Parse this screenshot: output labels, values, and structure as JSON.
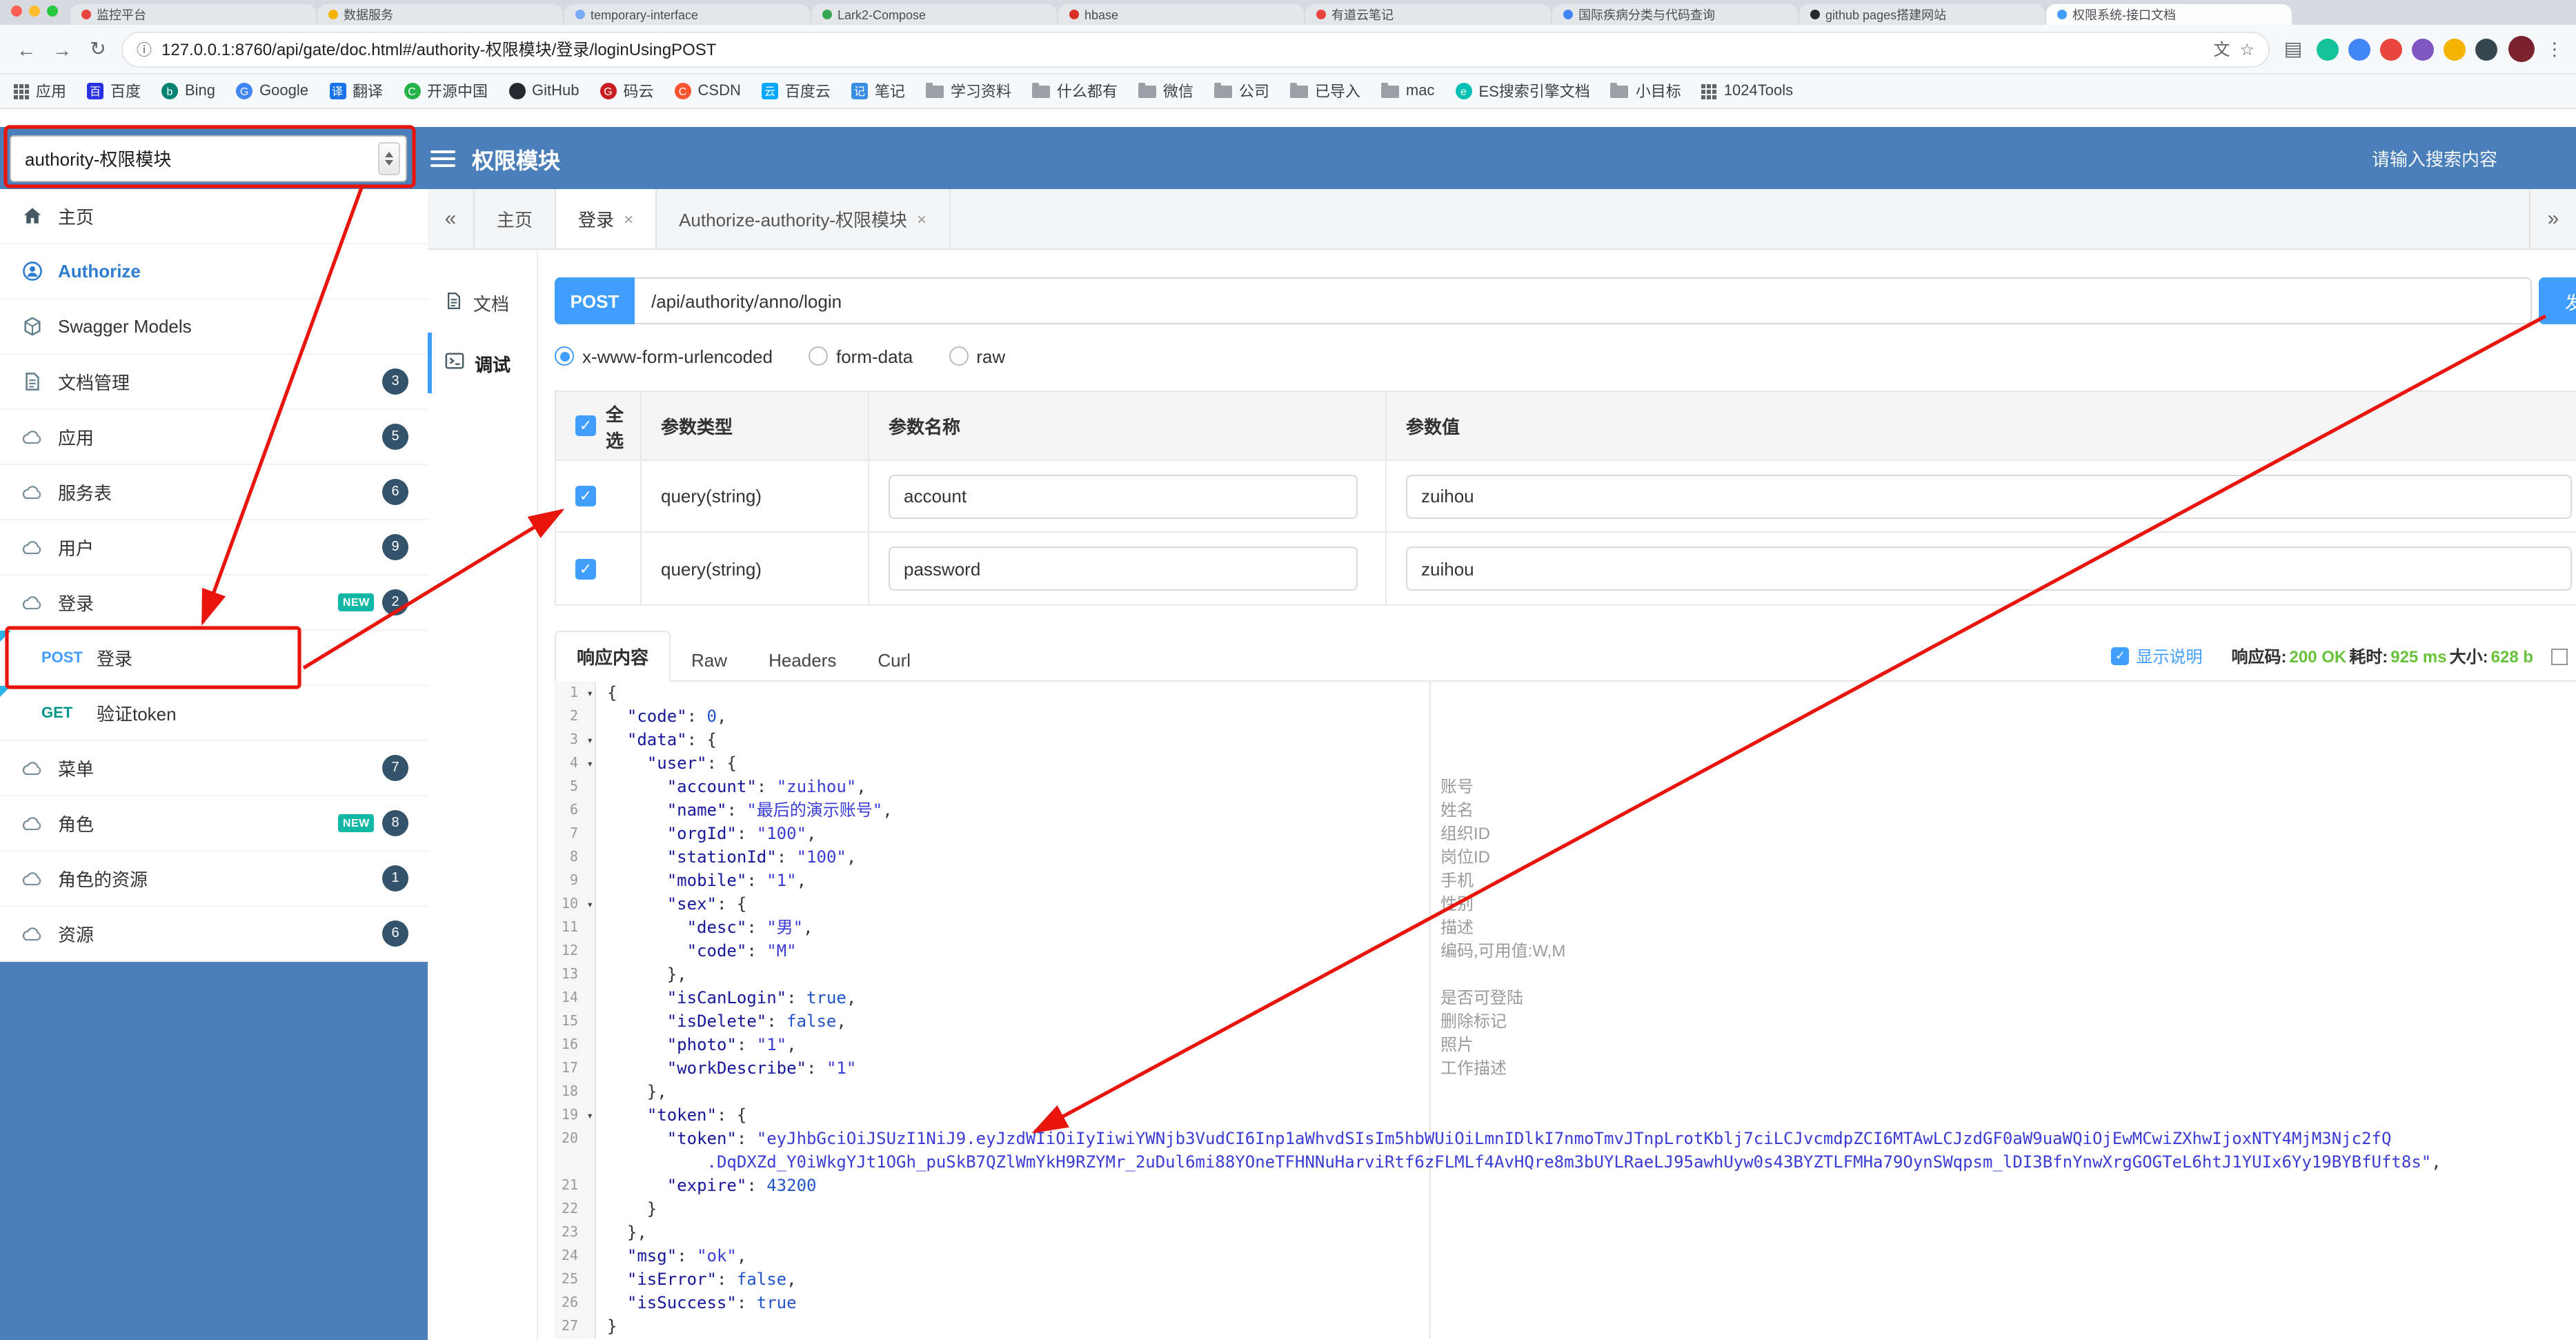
{
  "browser": {
    "window_lights": [
      "#ff5f57",
      "#febc2e",
      "#28c840"
    ],
    "tabs": [
      {
        "title": "监控平台",
        "favicon_color": "#e8453c"
      },
      {
        "title": "数据服务",
        "favicon_color": "#f4b400"
      },
      {
        "title": "temporary-interface",
        "favicon_color": "#7baaf7"
      },
      {
        "title": "Lark2-Compose",
        "favicon_color": "#34a853"
      },
      {
        "title": "hbase",
        "favicon_color": "#d93025"
      },
      {
        "title": "有道云笔记",
        "favicon_color": "#e8453c"
      },
      {
        "title": "国际疾病分类与代码查询",
        "favicon_color": "#4285f4"
      },
      {
        "title": "github pages搭建网站",
        "favicon_color": "#24292e"
      },
      {
        "title": "权限系统-接口文档",
        "favicon_color": "#409eff",
        "active": true
      }
    ],
    "toolbar": {
      "glyphs": {
        "back": "←",
        "forward": "→",
        "reload": "↻",
        "info": "ⓘ",
        "translate": "文",
        "star": "☆",
        "side_panel": "▤",
        "menu": "⋮"
      },
      "url": "127.0.0.1:8760/api/gate/doc.html#/authority-权限模块/登录/loginUsingPOST",
      "extension_colors": [
        "#15c39a",
        "#4285f4",
        "#e8453c",
        "#7e57c2",
        "#f4b400",
        "#37474f"
      ]
    },
    "bookmarks": [
      {
        "label": "应用",
        "icon": "apps-grid"
      },
      {
        "label": "百度",
        "icon": "letter",
        "text": "百",
        "bg": "#2932e1"
      },
      {
        "label": "Bing",
        "icon": "letter",
        "text": "b",
        "bg": "#008373",
        "shape": "circle"
      },
      {
        "label": "Google",
        "icon": "letter",
        "text": "G",
        "bg": "#4285f4",
        "shape": "circle"
      },
      {
        "label": "翻译",
        "icon": "letter",
        "text": "译",
        "bg": "#1a73e8"
      },
      {
        "label": "开源中国",
        "icon": "letter",
        "text": "C",
        "bg": "#24b34b",
        "shape": "circle"
      },
      {
        "label": "GitHub",
        "icon": "letter",
        "text": "",
        "bg": "#24292e",
        "shape": "circle"
      },
      {
        "label": "码云",
        "icon": "letter",
        "text": "G",
        "bg": "#c71d23",
        "shape": "circle"
      },
      {
        "label": "CSDN",
        "icon": "letter",
        "text": "C",
        "bg": "#fc5531",
        "shape": "circle"
      },
      {
        "label": "百度云",
        "icon": "letter",
        "text": "云",
        "bg": "#06a7ff"
      },
      {
        "label": "笔记",
        "icon": "letter",
        "text": "记",
        "bg": "#3a8ee6"
      },
      {
        "label": "学习资料",
        "icon": "folder"
      },
      {
        "label": "什么都有",
        "icon": "folder"
      },
      {
        "label": "微信",
        "icon": "folder"
      },
      {
        "label": "公司",
        "icon": "folder"
      },
      {
        "label": "已导入",
        "icon": "folder"
      },
      {
        "label": "mac",
        "icon": "folder"
      },
      {
        "label": "ES搜索引擎文档",
        "icon": "letter",
        "text": "e",
        "bg": "#00bfb3",
        "shape": "circle"
      },
      {
        "label": "小目标",
        "icon": "folder"
      },
      {
        "label": "1024Tools",
        "icon": "tools-grid"
      }
    ]
  },
  "header": {
    "module_select": "authority-权限模块",
    "title": "权限模块",
    "search_placeholder": "请输入搜索内容"
  },
  "sidebar": {
    "items": [
      {
        "label": "主页",
        "icon": "home-icon"
      },
      {
        "label": "Authorize",
        "icon": "authorize-icon",
        "highlight": true
      },
      {
        "label": "Swagger Models",
        "icon": "models-icon"
      },
      {
        "label": "文档管理",
        "icon": "docs-icon",
        "badge": "3"
      },
      {
        "label": "应用",
        "icon": "cloud-icon",
        "badge": "5"
      },
      {
        "label": "服务表",
        "icon": "cloud-icon",
        "badge": "6"
      },
      {
        "label": "用户",
        "icon": "cloud-icon",
        "badge": "9"
      },
      {
        "label": "登录",
        "icon": "cloud-icon",
        "badge": "2",
        "new_tag": "NEW",
        "expanded": true
      },
      {
        "type": "operation",
        "method": "POST",
        "label": "登录"
      },
      {
        "type": "operation",
        "method": "GET",
        "label": "验证token"
      },
      {
        "label": "菜单",
        "icon": "cloud-icon",
        "badge": "7"
      },
      {
        "label": "角色",
        "icon": "cloud-icon",
        "badge": "8",
        "new_tag": "NEW"
      },
      {
        "label": "角色的资源",
        "icon": "cloud-icon",
        "badge": "1"
      },
      {
        "label": "资源",
        "icon": "cloud-icon",
        "badge": "6"
      }
    ]
  },
  "main_tabs": {
    "collapse_left": "«",
    "collapse_right": "»",
    "items": [
      {
        "label": "主页"
      },
      {
        "label": "登录",
        "closable": true,
        "active": true
      },
      {
        "label": "Authorize-authority-权限模块",
        "closable": true
      }
    ]
  },
  "doc_tabs": {
    "items": [
      {
        "label": "文档",
        "icon": "doc-icon"
      },
      {
        "label": "调试",
        "icon": "debug-icon",
        "active": true
      }
    ]
  },
  "request": {
    "method": "POST",
    "url": "/api/authority/anno/login",
    "send_button_label": "发送",
    "content_types": [
      {
        "label": "x-www-form-urlencoded",
        "selected": true
      },
      {
        "label": "form-data",
        "selected": false
      },
      {
        "label": "raw",
        "selected": false
      }
    ],
    "params_table": {
      "select_all_label": "全选",
      "columns": [
        "参数类型",
        "参数名称",
        "参数值"
      ],
      "rows": [
        {
          "checked": true,
          "type": "query(string)",
          "name": "account",
          "value": "zuihou"
        },
        {
          "checked": true,
          "type": "query(string)",
          "name": "password",
          "value": "zuihou"
        }
      ]
    }
  },
  "response": {
    "tabs": [
      {
        "label": "响应内容",
        "active": true
      },
      {
        "label": "Raw"
      },
      {
        "label": "Headers"
      },
      {
        "label": "Curl"
      }
    ],
    "show_description": {
      "checked": true,
      "label": "显示说明"
    },
    "status": {
      "code_label": "响应码:",
      "code": "200 OK",
      "time_label": "耗时:",
      "time": "925 ms",
      "size_label": "大小:",
      "size": "628 b"
    }
  },
  "editor": {
    "fold_glyph": "▾",
    "rows": [
      {
        "n": "1",
        "fold": true,
        "t": [
          [
            "p",
            "{"
          ]
        ]
      },
      {
        "n": "2",
        "t": [
          [
            "p",
            "  "
          ],
          [
            "k",
            "\"code\""
          ],
          [
            "p",
            ": "
          ],
          [
            "n",
            "0"
          ],
          [
            "p",
            ","
          ]
        ]
      },
      {
        "n": "3",
        "fold": true,
        "t": [
          [
            "p",
            "  "
          ],
          [
            "k",
            "\"data\""
          ],
          [
            "p",
            ": {"
          ]
        ]
      },
      {
        "n": "4",
        "fold": true,
        "t": [
          [
            "p",
            "    "
          ],
          [
            "k",
            "\"user\""
          ],
          [
            "p",
            ": {"
          ]
        ]
      },
      {
        "n": "5",
        "t": [
          [
            "p",
            "      "
          ],
          [
            "k",
            "\"account\""
          ],
          [
            "p",
            ": "
          ],
          [
            "s",
            "\"zuihou\""
          ],
          [
            "p",
            ","
          ]
        ],
        "a": "账号"
      },
      {
        "n": "6",
        "t": [
          [
            "p",
            "      "
          ],
          [
            "k",
            "\"name\""
          ],
          [
            "p",
            ": "
          ],
          [
            "s",
            "\"最后的演示账号\""
          ],
          [
            "p",
            ","
          ]
        ],
        "a": "姓名"
      },
      {
        "n": "7",
        "t": [
          [
            "p",
            "      "
          ],
          [
            "k",
            "\"orgId\""
          ],
          [
            "p",
            ": "
          ],
          [
            "s",
            "\"100\""
          ],
          [
            "p",
            ","
          ]
        ],
        "a": "组织ID"
      },
      {
        "n": "8",
        "t": [
          [
            "p",
            "      "
          ],
          [
            "k",
            "\"stationId\""
          ],
          [
            "p",
            ": "
          ],
          [
            "s",
            "\"100\""
          ],
          [
            "p",
            ","
          ]
        ],
        "a": "岗位ID"
      },
      {
        "n": "9",
        "t": [
          [
            "p",
            "      "
          ],
          [
            "k",
            "\"mobile\""
          ],
          [
            "p",
            ": "
          ],
          [
            "s",
            "\"1\""
          ],
          [
            "p",
            ","
          ]
        ],
        "a": "手机"
      },
      {
        "n": "10",
        "fold": true,
        "t": [
          [
            "p",
            "      "
          ],
          [
            "k",
            "\"sex\""
          ],
          [
            "p",
            ": {"
          ]
        ],
        "a": "性别"
      },
      {
        "n": "11",
        "t": [
          [
            "p",
            "        "
          ],
          [
            "k",
            "\"desc\""
          ],
          [
            "p",
            ": "
          ],
          [
            "s",
            "\"男\""
          ],
          [
            "p",
            ","
          ]
        ],
        "a": "描述"
      },
      {
        "n": "12",
        "t": [
          [
            "p",
            "        "
          ],
          [
            "k",
            "\"code\""
          ],
          [
            "p",
            ": "
          ],
          [
            "s",
            "\"M\""
          ]
        ],
        "a": "编码,可用值:W,M"
      },
      {
        "n": "13",
        "t": [
          [
            "p",
            "      },"
          ]
        ]
      },
      {
        "n": "14",
        "t": [
          [
            "p",
            "      "
          ],
          [
            "k",
            "\"isCanLogin\""
          ],
          [
            "p",
            ": "
          ],
          [
            "b",
            "true"
          ],
          [
            "p",
            ","
          ]
        ],
        "a": "是否可登陆"
      },
      {
        "n": "15",
        "t": [
          [
            "p",
            "      "
          ],
          [
            "k",
            "\"isDelete\""
          ],
          [
            "p",
            ": "
          ],
          [
            "b",
            "false"
          ],
          [
            "p",
            ","
          ]
        ],
        "a": "删除标记"
      },
      {
        "n": "16",
        "t": [
          [
            "p",
            "      "
          ],
          [
            "k",
            "\"photo\""
          ],
          [
            "p",
            ": "
          ],
          [
            "s",
            "\"1\""
          ],
          [
            "p",
            ","
          ]
        ],
        "a": "照片"
      },
      {
        "n": "17",
        "t": [
          [
            "p",
            "      "
          ],
          [
            "k",
            "\"workDescribe\""
          ],
          [
            "p",
            ": "
          ],
          [
            "s",
            "\"1\""
          ]
        ],
        "a": "工作描述"
      },
      {
        "n": "18",
        "t": [
          [
            "p",
            "    },"
          ]
        ]
      },
      {
        "n": "19",
        "fold": true,
        "t": [
          [
            "p",
            "    "
          ],
          [
            "k",
            "\"token\""
          ],
          [
            "p",
            ": {"
          ]
        ]
      },
      {
        "n": "20",
        "t": [
          [
            "p",
            "      "
          ],
          [
            "k",
            "\"token\""
          ],
          [
            "p",
            ": "
          ],
          [
            "s",
            "\"eyJhbGciOiJSUzI1NiJ9.eyJzdWIiOiIyIiwiYWNjb3VudCI6Inp1aWhvdSIsIm5hbWUiOiLmnIDlkI7nmoTmvJTnpLrotKblj7ciLCJvcmdpZCI6MTAwLCJzdGF0aW9uaWQiOjEwMCwiZXhwIjoxNTY4MjM3Njc2fQ"
          ]
        ]
      },
      {
        "n": "",
        "t": [
          [
            "p",
            "          "
          ],
          [
            "s",
            ".DqDXZd_Y0iWkgYJt1OGh_puSkB7QZlWmYkH9RZYMr_2uDul6mi88YOneTFHNNuHarviRtf6zFLMLf4AvHQre8m3bUYLRaeLJ95awhUyw0s43BYZTLFMHa79OynSWqpsm_lDI3BfnYnwXrgGOGTeL6htJ1YUIx6Yy19BYBfUft8s\""
          ],
          [
            "p",
            ","
          ]
        ]
      },
      {
        "n": "21",
        "t": [
          [
            "p",
            "      "
          ],
          [
            "k",
            "\"expire\""
          ],
          [
            "p",
            ": "
          ],
          [
            "n",
            "43200"
          ]
        ]
      },
      {
        "n": "22",
        "t": [
          [
            "p",
            "    }"
          ]
        ]
      },
      {
        "n": "23",
        "t": [
          [
            "p",
            "  },"
          ]
        ]
      },
      {
        "n": "24",
        "t": [
          [
            "p",
            "  "
          ],
          [
            "k",
            "\"msg\""
          ],
          [
            "p",
            ": "
          ],
          [
            "s",
            "\"ok\""
          ],
          [
            "p",
            ","
          ]
        ]
      },
      {
        "n": "25",
        "t": [
          [
            "p",
            "  "
          ],
          [
            "k",
            "\"isError\""
          ],
          [
            "p",
            ": "
          ],
          [
            "b",
            "false"
          ],
          [
            "p",
            ","
          ]
        ]
      },
      {
        "n": "26",
        "t": [
          [
            "p",
            "  "
          ],
          [
            "k",
            "\"isSuccess\""
          ],
          [
            "p",
            ": "
          ],
          [
            "b",
            "true"
          ]
        ]
      },
      {
        "n": "27",
        "t": [
          [
            "p",
            "}"
          ]
        ]
      }
    ]
  }
}
